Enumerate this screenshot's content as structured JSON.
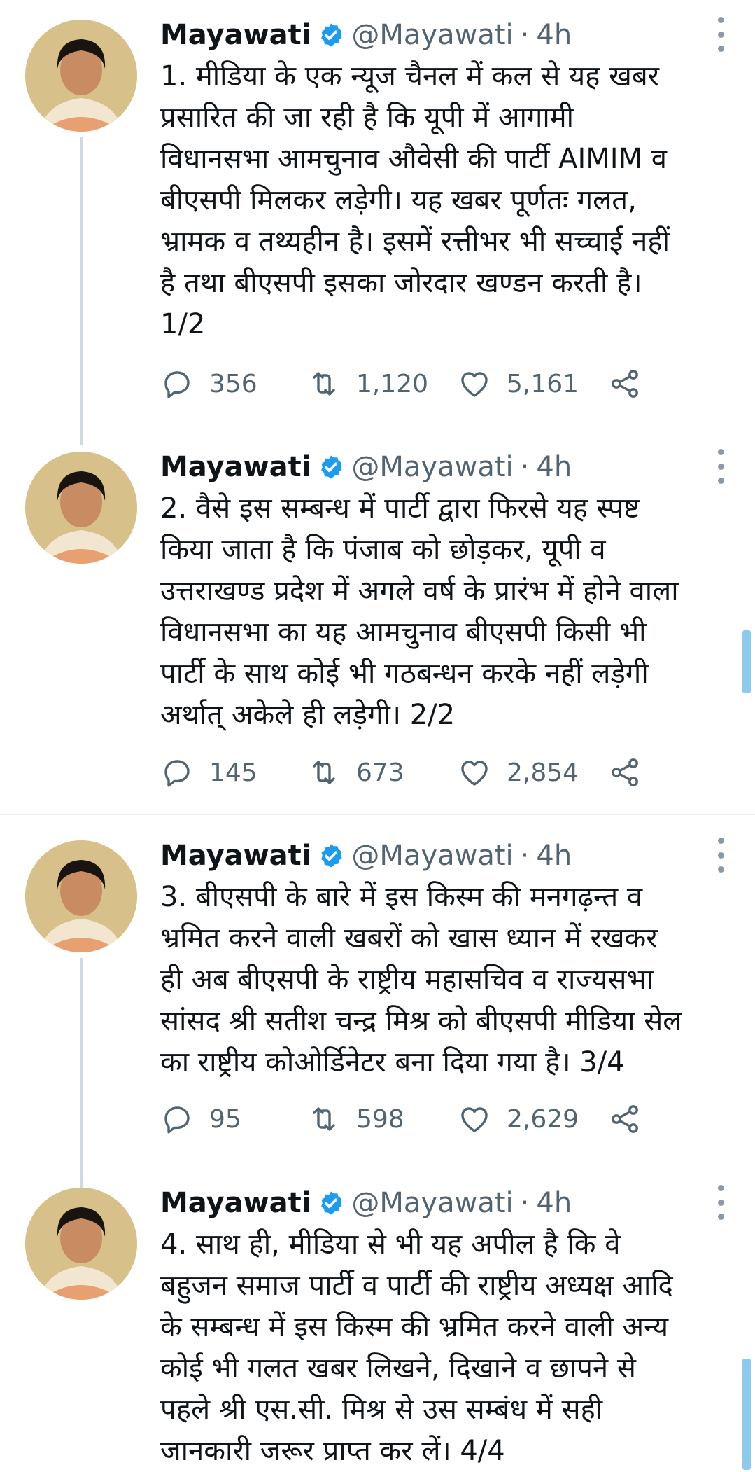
{
  "author": {
    "name": "Mayawati",
    "handle": "@Mayawati",
    "separator": "·",
    "time": "4h"
  },
  "colors": {
    "text": "#0f1419",
    "muted": "#536471",
    "verified": "#1d9bf0",
    "thread_line": "#cfd9de",
    "scrollbar": "#8fc9ee"
  },
  "tweets": [
    {
      "lines": [
        "1. मीडिया के एक न्यूज चैनल में कल से यह खबर",
        "प्रसारित की जा रही है कि यूपी में आगामी",
        "विधानसभा आमचुनाव औवेसी की पार्टी AIMIM  व",
        "बीएसपी मिलकर लड़ेगी। यह खबर पूर्णतः गलत,",
        "भ्रामक व तथ्यहीन है। इसमें रत्तीभर भी सच्चाई नहीं",
        "है तथा बीएसपी इसका जोरदार खण्डन करती है।",
        "1/2"
      ],
      "replies": "356",
      "retweets": "1,120",
      "likes": "5,161"
    },
    {
      "lines": [
        "2. वैसे इस सम्बन्ध में पार्टी द्वारा फिरसे यह स्पष्ट",
        "किया जाता है कि पंजाब को छोड़कर, यूपी व",
        "उत्तराखण्ड प्रदेश में अगले वर्ष के प्रारंभ में होने वाला",
        "विधानसभा का यह आमचुनाव बीएसपी किसी भी",
        "पार्टी के साथ कोई भी गठबन्धन करके नहीं लड़ेगी",
        "अर्थात् अकेले ही लड़ेगी। 2/2"
      ],
      "replies": "145",
      "retweets": "673",
      "likes": "2,854"
    },
    {
      "lines": [
        "3. बीएसपी के बारे में इस किस्म की मनगढ़न्त व",
        "भ्रमित करने वाली खबरों को खास ध्यान में रखकर",
        "ही अब बीएसपी के राष्ट्रीय महासचिव व राज्यसभा",
        "सांसद श्री सतीश चन्द्र मिश्र को बीएसपी मीडिया सेल",
        "का राष्ट्रीय कोओर्डिनेटर बना दिया गया है। 3/4"
      ],
      "replies": "95",
      "retweets": "598",
      "likes": "2,629"
    },
    {
      "lines": [
        "4. साथ ही, मीडिया से भी यह अपील है कि वे",
        "बहुजन समाज पार्टी व पार्टी की राष्ट्रीय अध्यक्ष आदि",
        "के सम्बन्ध में इस किस्म की भ्रमित करने वाली अन्य",
        "कोई भी गलत खबर लिखने, दिखाने व छापने से",
        "पहले श्री एस.सी. मिश्र से उस सम्बंध में सही",
        "जानकारी जरूर प्राप्त कर लें।  4/4"
      ]
    }
  ]
}
